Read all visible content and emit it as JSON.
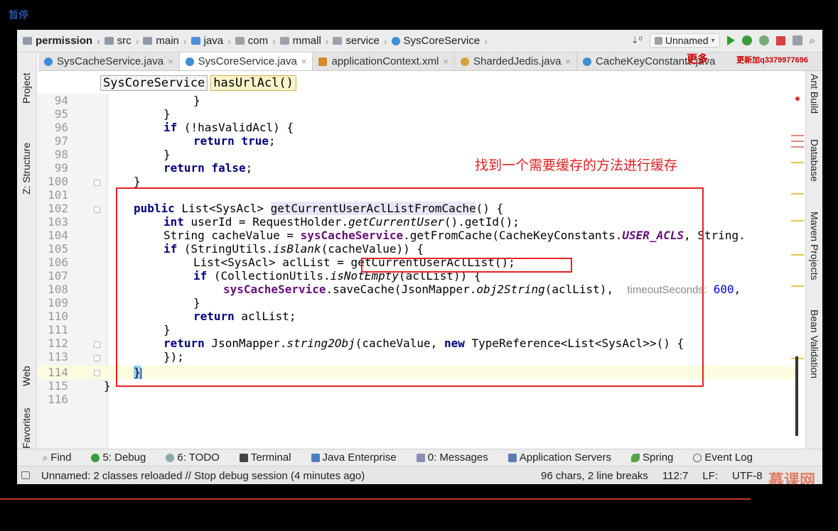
{
  "video": {
    "pause_label": "暂停"
  },
  "breadcrumb": [
    "permission",
    "src",
    "main",
    "java",
    "com",
    "mmall",
    "service",
    "SysCoreService"
  ],
  "toolbar": {
    "run_config": "Unnamed"
  },
  "watermark": {
    "more": "更多",
    "text": "更新加q3379977696"
  },
  "tabs": [
    {
      "label": "SysCacheService.java",
      "icon": "class"
    },
    {
      "label": "SysCoreService.java",
      "icon": "class",
      "active": true
    },
    {
      "label": "applicationContext.xml",
      "icon": "xml"
    },
    {
      "label": "ShardedJedis.java",
      "icon": "class"
    },
    {
      "label": "CacheKeyConstants.java",
      "icon": "class"
    }
  ],
  "method_crumb": {
    "class": "SysCoreService",
    "method": "hasUrlAcl()"
  },
  "left_tools": [
    "Project",
    "Z: Structure",
    "Web",
    "Favorites"
  ],
  "right_tools": [
    "Ant Build",
    "Database",
    "Maven Projects",
    "Bean Validation"
  ],
  "code": {
    "lines": [
      "94",
      "95",
      "96",
      "97",
      "98",
      "99",
      "100",
      "101",
      "102",
      "103",
      "104",
      "105",
      "106",
      "107",
      "108",
      "109",
      "110",
      "111",
      "112",
      "113",
      "114",
      "115",
      "116"
    ],
    "text": {
      "l94": "}",
      "l95": "}",
      "l96_kw": "if",
      "l96_rest": " (!hasValidAcl) {",
      "l97_kw": "return",
      "l97_val": "true",
      "l97_end": ";",
      "l98": "}",
      "l99_kw": "return",
      "l99_val": "false",
      "l99_end": ";",
      "l100": "}",
      "l102_kw": "public",
      "l102_type": " List<SysAcl> ",
      "l102_name": "getCurrentUserAclListFromCache",
      "l102_end": "() {",
      "l103_kw": "int",
      "l103_a": " userId = RequestHolder.",
      "l103_static": "getCurrentUser",
      "l103_b": "().getId();",
      "l104_a": "String cacheValue = ",
      "l104_field": "sysCacheService",
      "l104_b": ".getFromCache(CacheKeyConstants.",
      "l104_const": "USER_ACLS",
      "l104_c": ", String.",
      "l105_kw": "if",
      "l105_a": " (StringUtils.",
      "l105_static": "isBlank",
      "l105_b": "(cacheValue)) {",
      "l106": "List<SysAcl> aclList = getCurrentUserAclList();",
      "l107_kw": "if",
      "l107_a": " (CollectionUtils.",
      "l107_static": "isNotEmpty",
      "l107_b": "(aclList)) {",
      "l108_field": "sysCacheService",
      "l108_a": ".saveCache(JsonMapper.",
      "l108_static": "obj2String",
      "l108_b": "(aclList), ",
      "l108_hint": "timeoutSeconds:",
      "l108_num": "600",
      "l108_c": ",",
      "l109": "}",
      "l110_kw": "return",
      "l110_a": " aclList;",
      "l111": "}",
      "l112_kw": "return",
      "l112_a": " JsonMapper.",
      "l112_static": "string2Obj",
      "l112_b": "(cacheValue, ",
      "l112_kw2": "new",
      "l112_c": " TypeReference<List<SysAcl>>() {",
      "l113": "});",
      "l114": "}",
      "l115": "}"
    }
  },
  "annotation": {
    "text": "找到一个需要缓存的方法进行缓存"
  },
  "bottom_tools": [
    {
      "label": "Find"
    },
    {
      "label": "5: Debug"
    },
    {
      "label": "6: TODO"
    },
    {
      "label": "Terminal"
    },
    {
      "label": "Java Enterprise"
    },
    {
      "label": "0: Messages"
    },
    {
      "label": "Application Servers"
    },
    {
      "label": "Spring"
    },
    {
      "label": "Event Log"
    }
  ],
  "status": {
    "message": "Unnamed: 2 classes reloaded // Stop debug session (4 minutes ago)",
    "chars": "96 chars, 2 line breaks",
    "position": "112:7",
    "line_sep": "LF:",
    "encoding": "UTF-8",
    "brand": "慕课网"
  },
  "colors": {
    "keyword": "#000080",
    "field": "#660e7a",
    "annotation": "#e02020"
  }
}
